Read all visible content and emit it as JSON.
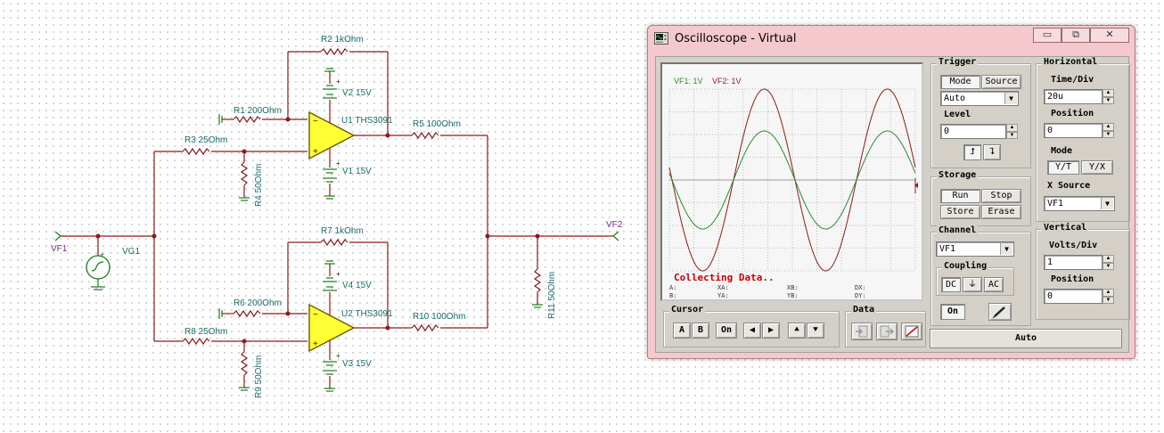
{
  "schematic": {
    "labels": {
      "r1": "R1 200Ohm",
      "r2": "R2 1kOhm",
      "r3": "R3 25Ohm",
      "r4": "R4 50Ohm",
      "r5": "R5 100Ohm",
      "r6": "R6 200Ohm",
      "r7": "R7 1kOhm",
      "r8": "R8 25Ohm",
      "r9": "R9 50Ohm",
      "r10": "R10 100Ohm",
      "r11": "R11 50Ohm",
      "v1": "V1 15V",
      "v2": "V2 15V",
      "v3": "V3 15V",
      "v4": "V4 15V",
      "u1": "U1 THS3091",
      "u2": "U2 THS3091",
      "vg1": "VG1",
      "vf1": "VF1",
      "vf2": "VF2"
    }
  },
  "oscilloscope": {
    "title": "Oscilloscope - Virtual",
    "window_buttons": {
      "minimize": "▭",
      "restore": "⧉",
      "close": "✕"
    },
    "screen": {
      "legend_vf1": "VF1: 1V",
      "legend_vf2": "VF2: 1V",
      "status": "Collecting Data..",
      "readout": {
        "a": "A:",
        "b": "B:",
        "xa": "XA:",
        "ya": "YA:",
        "xb": "XB:",
        "yb": "YB:",
        "dx": "DX:",
        "dy": "DY:"
      },
      "colors": {
        "vf1": "#2a8a2a",
        "vf2": "#8b1a1a",
        "status": "#cc0000"
      }
    },
    "trigger": {
      "title": "Trigger",
      "mode_btn": "Mode",
      "source_btn": "Source",
      "mode_value": "Auto",
      "level_label": "Level",
      "level_value": "0",
      "rise_icon": "⮥",
      "fall_icon": "⮧"
    },
    "horizontal": {
      "title": "Horizontal",
      "time_div_label": "Time/Div",
      "time_div_value": "20u",
      "position_label": "Position",
      "position_value": "0",
      "mode_label": "Mode",
      "yt": "Y/T",
      "yx": "Y/X",
      "x_source_label": "X Source",
      "x_source_value": "VF1"
    },
    "storage": {
      "title": "Storage",
      "run": "Run",
      "stop": "Stop",
      "store": "Store",
      "erase": "Erase"
    },
    "channel": {
      "title": "Channel",
      "value": "VF1",
      "coupling_title": "Coupling",
      "dc": "DC",
      "ground": "⏚",
      "ac": "AC",
      "on": "On"
    },
    "vertical": {
      "title": "Vertical",
      "volts_div_label": "Volts/Div",
      "volts_div_value": "1",
      "position_label": "Position",
      "position_value": "0"
    },
    "cursor": {
      "title": "Cursor",
      "a": "A",
      "b": "B",
      "on": "On",
      "left": "◀",
      "right": "▶",
      "up": "⯅",
      "down": "⯆"
    },
    "data": {
      "title": "Data"
    },
    "auto": "Auto"
  }
}
